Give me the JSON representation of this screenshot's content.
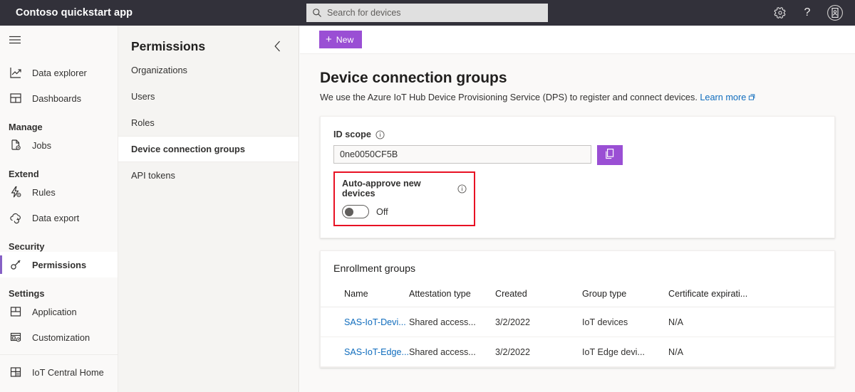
{
  "topbar": {
    "app_title": "Contoso quickstart app",
    "search": {
      "placeholder": "Search for devices",
      "value": "",
      "icon": "search-icon"
    },
    "actions": [
      {
        "icon": "gear-icon",
        "label": "Settings"
      },
      {
        "icon": "question-mark-icon",
        "label": "Help"
      },
      {
        "icon": "avatar-icon",
        "label": "Account"
      }
    ],
    "background": "#32313a"
  },
  "leftnav": {
    "menu_icon": "hamburger-icon",
    "items": [
      {
        "type": "item",
        "label": "Data explorer",
        "icon": "data-explorer-icon",
        "selected": false
      },
      {
        "type": "item",
        "label": "Dashboards",
        "icon": "dashboards-icon",
        "selected": false
      },
      {
        "type": "group",
        "label": "Manage"
      },
      {
        "type": "item",
        "label": "Jobs",
        "icon": "jobs-icon",
        "selected": false
      },
      {
        "type": "group",
        "label": "Extend"
      },
      {
        "type": "item",
        "label": "Rules",
        "icon": "rules-icon",
        "selected": false
      },
      {
        "type": "item",
        "label": "Data export",
        "icon": "data-export-icon",
        "selected": false
      },
      {
        "type": "group",
        "label": "Security"
      },
      {
        "type": "item",
        "label": "Permissions",
        "icon": "permissions-key-icon",
        "selected": true
      },
      {
        "type": "group",
        "label": "Settings"
      },
      {
        "type": "item",
        "label": "Application",
        "icon": "application-icon",
        "selected": false
      },
      {
        "type": "item",
        "label": "Customization",
        "icon": "customization-icon",
        "selected": false
      },
      {
        "type": "divider"
      },
      {
        "type": "item",
        "label": "IoT Central Home",
        "icon": "home-grid-icon",
        "selected": false
      }
    ],
    "accent_color": "#8661c5"
  },
  "subnav": {
    "title": "Permissions",
    "collapse_icon": "chevron-left-icon",
    "items": [
      {
        "label": "Organizations",
        "selected": false
      },
      {
        "label": "Users",
        "selected": false
      },
      {
        "label": "Roles",
        "selected": false
      },
      {
        "label": "Device connection groups",
        "selected": true
      },
      {
        "label": "API tokens",
        "selected": false
      }
    ]
  },
  "commandbar": {
    "new_label": "New",
    "new_icon": "plus-icon",
    "new_color": "#9a4fd4"
  },
  "page": {
    "title": "Device connection groups",
    "description": "We use the Azure IoT Hub Device Provisioning Service (DPS) to register and connect devices.",
    "learn_more": "Learn more",
    "learn_more_icon": "external-link-icon",
    "link_color": "#0f6cbd"
  },
  "idscope_card": {
    "label": "ID scope",
    "info_icon": "info-icon",
    "value": "0ne0050CF5B",
    "copy_icon": "copy-icon",
    "copy_button_color": "#9a4fd4"
  },
  "auto_approve": {
    "label": "Auto-approve new devices",
    "info_icon": "info-icon",
    "toggle_state": "Off",
    "toggle_on": false,
    "highlight_color": "#e81123"
  },
  "enrollment": {
    "card_title": "Enrollment groups",
    "columns": [
      "Name",
      "Attestation type",
      "Created",
      "Group type",
      "Certificate expirati..."
    ],
    "rows": [
      {
        "name": "SAS-IoT-Devi...",
        "attestation_type": "Shared access...",
        "created": "3/2/2022",
        "group_type": "IoT devices",
        "certificate_expiration": "N/A"
      },
      {
        "name": "SAS-IoT-Edge...",
        "attestation_type": "Shared access...",
        "created": "3/2/2022",
        "group_type": "IoT Edge devi...",
        "certificate_expiration": "N/A"
      }
    ]
  }
}
